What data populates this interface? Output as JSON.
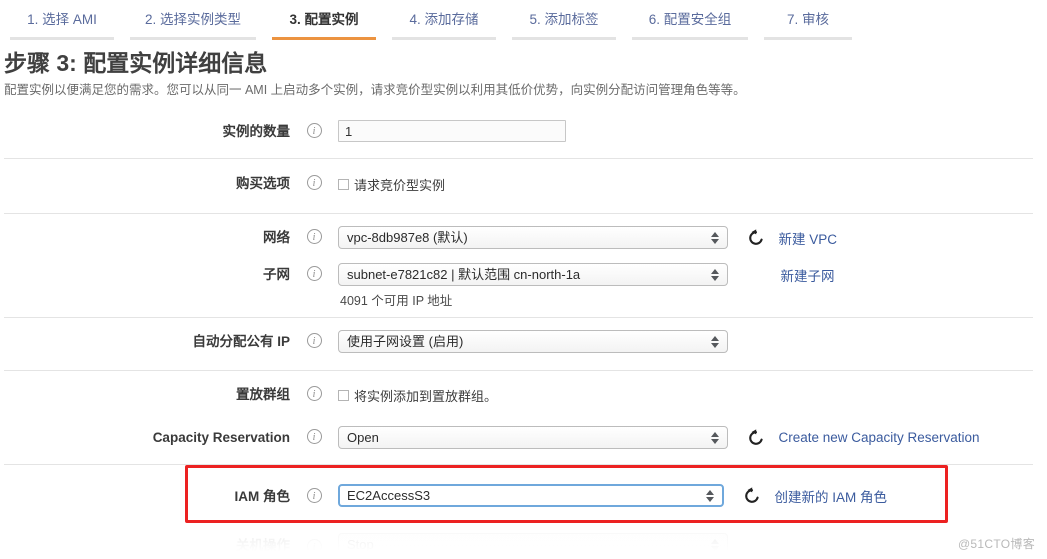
{
  "wizard": {
    "tabs": [
      {
        "label": "1. 选择 AMI",
        "active": false
      },
      {
        "label": "2. 选择实例类型",
        "active": false
      },
      {
        "label": "3. 配置实例",
        "active": true
      },
      {
        "label": "4. 添加存储",
        "active": false
      },
      {
        "label": "5. 添加标签",
        "active": false
      },
      {
        "label": "6. 配置安全组",
        "active": false
      },
      {
        "label": "7. 审核",
        "active": false
      }
    ]
  },
  "header": {
    "title": "步骤 3: 配置实例详细信息",
    "description": "配置实例以便满足您的需求。您可以从同一 AMI 上启动多个实例，请求竞价型实例以利用其低价优势，向实例分配访问管理角色等等。"
  },
  "form": {
    "instance_count": {
      "label": "实例的数量",
      "info": "i",
      "value": "1"
    },
    "purchase_option": {
      "label": "购买选项",
      "info": "i",
      "checkbox_label": "请求竞价型实例",
      "checked": false
    },
    "network": {
      "label": "网络",
      "info": "i",
      "value": "vpc-8db987e8 (默认)",
      "link": "新建 VPC",
      "refresh": "refresh-icon"
    },
    "subnet": {
      "label": "子网",
      "info": "i",
      "value": "subnet-e7821c82 | 默认范围 cn-north-1a",
      "link": "新建子网",
      "note": "4091 个可用 IP 地址"
    },
    "auto_assign_ip": {
      "label": "自动分配公有 IP",
      "info": "i",
      "value": "使用子网设置 (启用)"
    },
    "placement_group": {
      "label": "置放群组",
      "info": "i",
      "checkbox_label": "将实例添加到置放群组。",
      "checked": false
    },
    "capacity_reservation": {
      "label": "Capacity Reservation",
      "info": "i",
      "value": "Open",
      "link": "Create new Capacity Reservation",
      "refresh": "refresh-icon"
    },
    "iam_role": {
      "label": "IAM 角色",
      "info": "i",
      "value": "EC2AccessS3",
      "link": "创建新的 IAM 角色",
      "refresh": "refresh-icon",
      "highlight_color": "#ec2121"
    },
    "cut_off_row": {
      "label": "关机操作",
      "info": "i",
      "value": "Stop"
    }
  },
  "watermark": "@51CTO博客"
}
